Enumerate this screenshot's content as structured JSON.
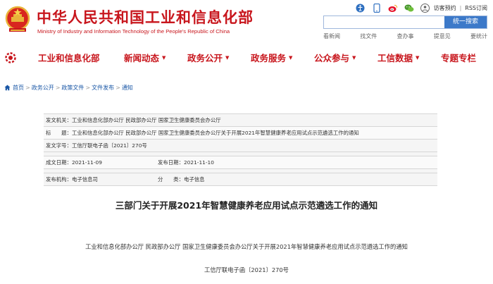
{
  "header": {
    "site_title": "中华人民共和国工业和信息化部",
    "site_subtitle": "Ministry of Industry and Information Technology of the People's Republic of China",
    "utilities": {
      "visitor_guide": "访客预约",
      "separator": "|",
      "rss": "RSS订阅"
    },
    "search": {
      "placeholder": "",
      "button_label": "统一搜索"
    },
    "quick_links": [
      "看新闻",
      "找文件",
      "查办事",
      "提意见",
      "要统计"
    ]
  },
  "nav": {
    "items": [
      "工业和信息化部",
      "新闻动态",
      "政务公开",
      "政务服务",
      "公众参与",
      "工信数据",
      "专题专栏"
    ]
  },
  "breadcrumb": {
    "items": [
      "首页",
      "政务公开",
      "政策文件",
      "文件发布",
      "通知"
    ],
    "separator": ">"
  },
  "meta": {
    "issuing_org_label": "发文机关：",
    "issuing_org_value": "工业和信息化部办公厅 民政部办公厅 国家卫生健康委员会办公厅",
    "title_label": "标　　题：",
    "title_value": "工业和信息化部办公厅 民政部办公厅 国家卫生健康委员会办公厅关于开展2021年智慧健康养老应用试点示范遴选工作的通知",
    "doc_no_label": "发文字号：",
    "doc_no_value": "工信厅联电子函〔2021〕270号",
    "written_date_label": "成文日期：",
    "written_date_value": "2021-11-09",
    "publish_date_label": "发布日期：",
    "publish_date_value": "2021-11-10",
    "publisher_label": "发布机构：",
    "publisher_value": "电子信息司",
    "category_label": "分　　类：",
    "category_value": "电子信息"
  },
  "article": {
    "title": "三部门关于开展2021年智慧健康养老应用试点示范遴选工作的通知",
    "issuer_line": "工业和信息化部办公厅 民政部办公厅 国家卫生健康委员会办公厅关于开展2021年智慧健康养老应用试点示范遴选工作的通知",
    "doc_no_line": "工信厅联电子函〔2021〕270号"
  },
  "colors": {
    "brand_red": "#c8161d",
    "link_blue": "#1a57a6",
    "search_blue": "#3c79c9"
  }
}
